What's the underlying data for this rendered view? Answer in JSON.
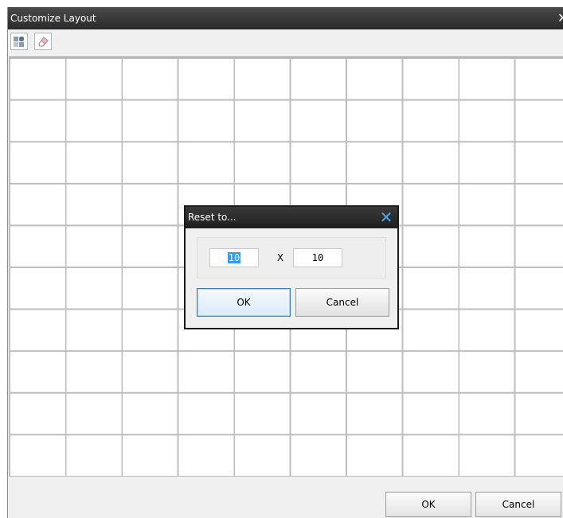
{
  "window": {
    "title": "Customize Layout",
    "close_glyph": "✕"
  },
  "toolbar": {
    "icons": [
      "reset-grid-icon",
      "eraser-icon"
    ]
  },
  "grid": {
    "columns": 10,
    "rows": 10
  },
  "footer": {
    "ok_label": "OK",
    "cancel_label": "Cancel"
  },
  "dialog": {
    "title": "Reset to...",
    "close_glyph": "✕",
    "columns_value": "10",
    "separator": "X",
    "rows_value": "10",
    "ok_label": "OK",
    "cancel_label": "Cancel"
  },
  "colors": {
    "titlebar": "#2a2a2a",
    "dialog_close": "#4aa6e8",
    "selection": "#3399ff",
    "default_button_border": "#3c7fb1"
  }
}
